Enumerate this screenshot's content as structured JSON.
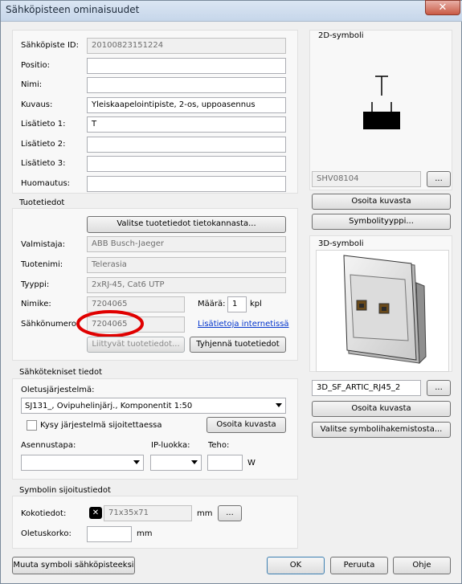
{
  "window": {
    "title": "Sähköpisteen ominaisuudet",
    "close_glyph": "✕"
  },
  "fields": {
    "id_label": "Sähköpiste ID:",
    "id_value": "20100823151224",
    "positio_label": "Positio:",
    "positio_value": "",
    "nimi_label": "Nimi:",
    "nimi_value": "",
    "kuvaus_label": "Kuvaus:",
    "kuvaus_value": "Yleiskaapelointipiste, 2-os, uppoasennus",
    "lisatieto1_label": "Lisätieto 1:",
    "lisatieto1_value": "T",
    "lisatieto2_label": "Lisätieto 2:",
    "lisatieto2_value": "",
    "lisatieto3_label": "Lisätieto 3:",
    "lisatieto3_value": "",
    "huomautus_label": "Huomautus:",
    "huomautus_value": ""
  },
  "tuotetiedot": {
    "section": "Tuotetiedot",
    "select_button": "Valitse tuotetiedot tietokannasta...",
    "valmistaja_label": "Valmistaja:",
    "valmistaja_value": "ABB Busch-Jaeger",
    "tuotenimi_label": "Tuotenimi:",
    "tuotenimi_value": "Telerasia",
    "tyyppi_label": "Tyyppi:",
    "tyyppi_value": "2xRJ-45, Cat6 UTP",
    "nimike_label": "Nimike:",
    "nimike_value": "7204065",
    "maara_label": "Määrä:",
    "maara_value": "1",
    "maara_unit": "kpl",
    "sahkonumero_label": "Sähkönumero:",
    "sahkonumero_value": "7204065",
    "internet_link": "Lisätietoja internetissä",
    "related_button": "Liittyvät tuotetiedot...",
    "clear_button": "Tyhjennä tuotetiedot",
    "highlight_color": "#e00000"
  },
  "sahkotekniset": {
    "section": "Sähkötekniset tiedot",
    "oletus_label": "Oletusjärjestelmä:",
    "oletus_value": "SJ131_, Ovipuhelinjärj., Komponentit 1:50",
    "kysy_label": "Kysy järjestelmä sijoitettaessa",
    "osoita_button": "Osoita kuvasta",
    "asennustapa_label": "Asennustapa:",
    "asennustapa_value": "",
    "ip_label": "IP-luokka:",
    "ip_value": "",
    "teho_label": "Teho:",
    "teho_value": "",
    "teho_unit": "W"
  },
  "symboli": {
    "section": "Symbolin sijoitustiedot",
    "koko_label": "Kokotiedot:",
    "koko_value": "71x35x71",
    "koko_unit": "mm",
    "koko_button": "...",
    "korko_label": "Oletuskorko:",
    "korko_value": "",
    "korko_unit": "mm"
  },
  "symbol2d": {
    "section": "2D-symboli",
    "name_value": "SHV08104",
    "browse_button": "...",
    "osoita_button": "Osoita kuvasta",
    "tyyppi_button": "Symbolityyppi..."
  },
  "symbol3d": {
    "section": "3D-symboli",
    "name_value": "3D_SF_ARTIC_RJ45_2",
    "browse_button": "...",
    "osoita_button": "Osoita kuvasta",
    "library_button": "Valitse symbolihakemistosta..."
  },
  "footer": {
    "muuta_button": "Muuta symboli sähköpisteeksi",
    "ok_button": "OK",
    "cancel_button": "Peruuta",
    "help_button": "Ohje"
  }
}
